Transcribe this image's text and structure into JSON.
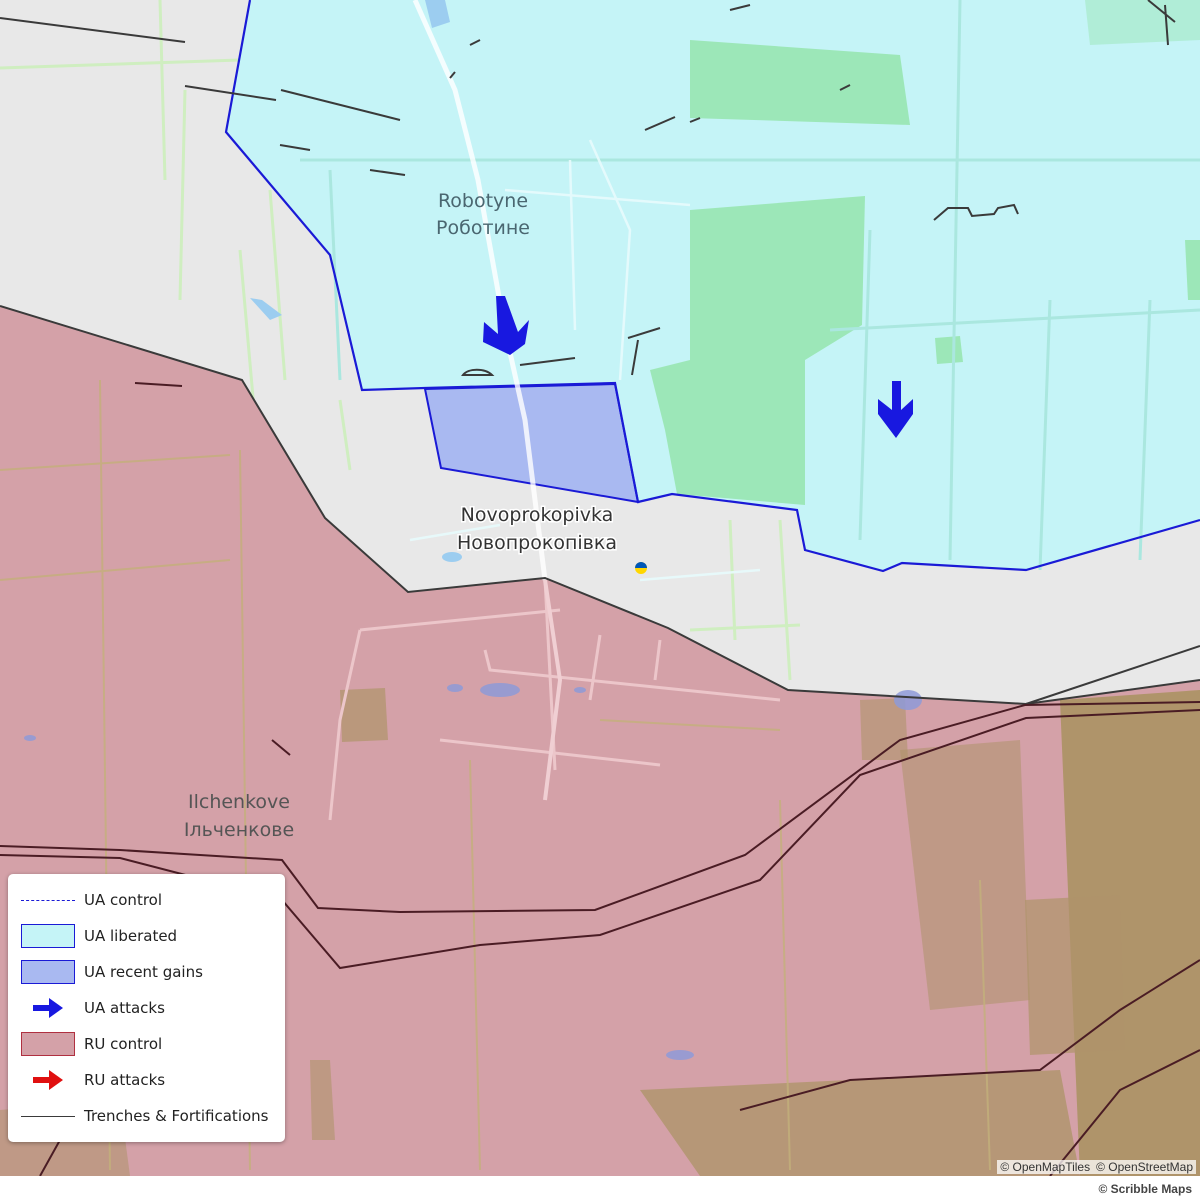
{
  "map": {
    "places": [
      {
        "id": "robotyne",
        "latin": "Robotyne",
        "cyrillic": "Роботине"
      },
      {
        "id": "novoprokopivka",
        "latin": "Novoprokopivka",
        "cyrillic": "Новопрокопівка"
      },
      {
        "id": "ilchenkove",
        "latin": "Ilchenkove",
        "cyrillic": "Ільченкове"
      }
    ],
    "colors": {
      "background": "#e8e8e8",
      "ua_liberated_fill": "#c5f4f7",
      "ua_border": "#1a1ad6",
      "ua_recent_gains_fill": "#a9b9f1",
      "ru_control_fill": "#d4a1a8",
      "ru_border": "#b03040",
      "ua_attack_arrow": "#1818e0",
      "ru_attack_arrow": "#e01010",
      "trench_line": "#3a3a3a",
      "field_green": "#98e6b0",
      "field_olive": "#a8925f",
      "water": "#9ccdf0"
    }
  },
  "legend": {
    "items": [
      {
        "label": "UA control",
        "symbol": "dashed-blue-line"
      },
      {
        "label": "UA liberated",
        "symbol": "cyan-swatch"
      },
      {
        "label": "UA recent gains",
        "symbol": "blue-swatch"
      },
      {
        "label": "UA attacks",
        "symbol": "blue-arrow-icon"
      },
      {
        "label": "RU control",
        "symbol": "red-swatch"
      },
      {
        "label": "RU attacks",
        "symbol": "red-arrow-icon"
      },
      {
        "label": "Trenches & Fortifications",
        "symbol": "dark-line"
      }
    ]
  },
  "attribution": {
    "openmaptiles": "© OpenMapTiles",
    "openstreetmap": "© OpenStreetMap",
    "scribble": "© Scribble Maps"
  }
}
